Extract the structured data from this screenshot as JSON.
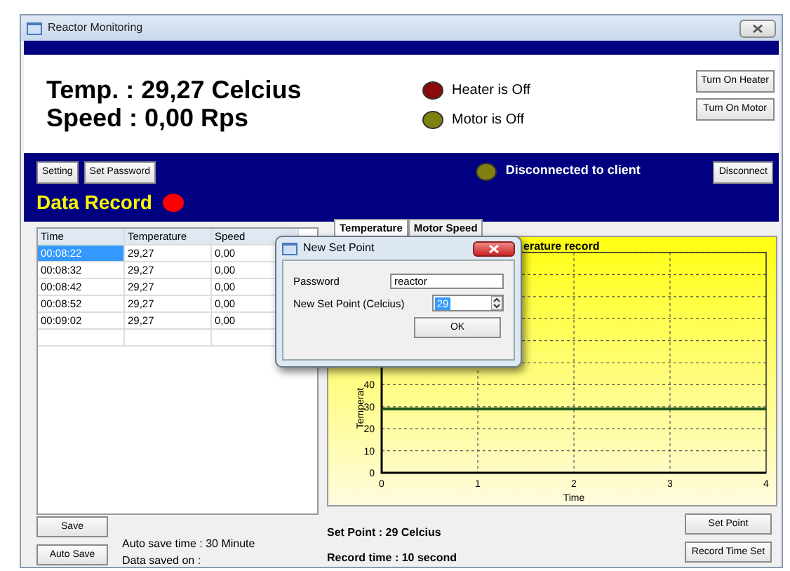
{
  "window": {
    "title": "Reactor Monitoring"
  },
  "status": {
    "temperature": "Temp. : 29,27 Celcius",
    "speed": "Speed : 0,00 Rps"
  },
  "indicators": [
    {
      "label": "Heater is Off",
      "color": "#8b0a0a"
    },
    {
      "label": "Motor is Off",
      "color": "#808010"
    }
  ],
  "control_buttons": [
    "Turn On Heater",
    "Turn On Motor"
  ],
  "toolbar_buttons": [
    "Setting",
    "Set Password"
  ],
  "data_record": {
    "title": "Data Record"
  },
  "connection": {
    "label": "Disconnected to client",
    "connected": false,
    "button": "Disconnect"
  },
  "table": {
    "columns": [
      "Time",
      "Temperature",
      "Speed"
    ],
    "rows": [
      {
        "cells": [
          "00:08:22",
          "29,27",
          "0,00"
        ],
        "selected": true
      },
      {
        "cells": [
          "00:08:32",
          "29,27",
          "0,00"
        ],
        "selected": false
      },
      {
        "cells": [
          "00:08:42",
          "29,27",
          "0,00"
        ],
        "selected": false
      },
      {
        "cells": [
          "00:08:52",
          "29,27",
          "0,00"
        ],
        "selected": false
      },
      {
        "cells": [
          "00:09:02",
          "29,27",
          "0,00"
        ],
        "selected": false
      }
    ]
  },
  "tabs": [
    {
      "label": "Temperature",
      "selected": true
    },
    {
      "label": "Motor Speed",
      "selected": false
    }
  ],
  "chart": {
    "chart_data": {
      "type": "line",
      "title": "erature record",
      "xlabel": "Time",
      "ylabel": "Temperat",
      "x": [
        0,
        4
      ],
      "series": [
        {
          "color": "#1f5a1f",
          "values": [
            29,
            29
          ]
        }
      ],
      "grid": true,
      "xlim": [
        0,
        4
      ],
      "ylim": [
        0,
        100
      ],
      "xticks": [
        0,
        1,
        2,
        3,
        4
      ],
      "yticks": [
        0,
        10,
        20,
        30,
        40
      ]
    }
  },
  "dialog": {
    "title": "New Set Point",
    "password_label": "Password",
    "password": "reactor",
    "setpoint_label": "New Set Point (Celcius)",
    "setpoint": "29",
    "ok": "OK"
  },
  "bottom": {
    "save_buttons": [
      "Save",
      "Auto Save"
    ],
    "auto_save_info": [
      "Auto save time : 30 Minute",
      "Data saved on :"
    ],
    "set_point": "Set Point : 29 Celcius",
    "record_time": "Record time : 10 second",
    "right_buttons": [
      "Set Point",
      "Record Time Set"
    ]
  }
}
